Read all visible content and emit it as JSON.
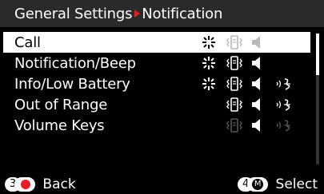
{
  "header": {
    "left": "General Settings",
    "right": "Notification"
  },
  "rows": [
    {
      "label": "Call",
      "light": "on",
      "vibrate": "off",
      "sound": "off",
      "assist": "none"
    },
    {
      "label": "Notification/Beep",
      "light": "on",
      "vibrate": "on",
      "sound": "on",
      "assist": "none"
    },
    {
      "label": "Info/Low Battery",
      "light": "on",
      "vibrate": "on",
      "sound": "on",
      "assist": "on"
    },
    {
      "label": "Out of Range",
      "light": "none",
      "vibrate": "on",
      "sound": "on",
      "assist": "on"
    },
    {
      "label": "Volume Keys",
      "light": "none",
      "vibrate": "off",
      "sound": "on",
      "assist": "off"
    }
  ],
  "footer": {
    "back_num": "3",
    "back_label": "Back",
    "select_num": "4",
    "select_letter": "M",
    "select_label": "Select"
  },
  "colors": {
    "accent": "#e81e26",
    "on": "#ffffff",
    "off": "#555555"
  }
}
